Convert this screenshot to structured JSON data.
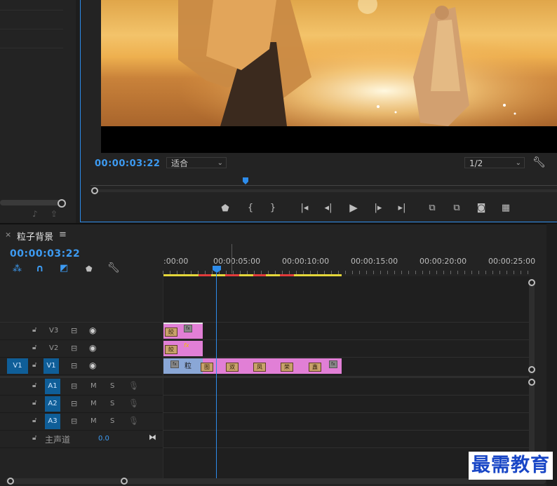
{
  "program_monitor": {
    "timecode": "00:00:03:22",
    "fit_dropdown": "适合",
    "resolution_dropdown": "1/2"
  },
  "transport": {
    "mark_in": "{",
    "mark_out": "}"
  },
  "timeline": {
    "tab_title": "粒子背景",
    "tab_close": "×",
    "tab_menu": "≡",
    "timecode": "00:00:03:22",
    "ruler_labels": [
      ":00:00",
      "00:00:05:00",
      "00:00:10:00",
      "00:00:15:00",
      "00:00:20:00",
      "00:00:25:00"
    ],
    "video_tracks": [
      {
        "name": "V3",
        "toggle": ""
      },
      {
        "name": "V2",
        "toggle": ""
      },
      {
        "name": "V1",
        "toggle": "V1"
      }
    ],
    "audio_tracks": [
      {
        "name": "A1",
        "mute": "M",
        "solo": "S"
      },
      {
        "name": "A2",
        "mute": "M",
        "solo": "S"
      },
      {
        "name": "A3",
        "mute": "M",
        "solo": "S"
      }
    ],
    "master": {
      "label": "主声道",
      "value": "0.0"
    },
    "clips": {
      "v1_label": "粒",
      "v1_thumbs": [
        "双",
        "凤",
        "荣",
        "鑫"
      ],
      "v3_thumb": "皎",
      "v2_thumb": "皎",
      "v2_fx": "fx",
      "fx_badge": "fx"
    }
  },
  "watermark": "最需教育",
  "colors": {
    "accent": "#2d8ceb",
    "clip_pink": "#e17fd6",
    "clip_blue": "#8aa7d6",
    "track_blue": "#0f5e98",
    "watermark_blue": "#1846c6"
  }
}
